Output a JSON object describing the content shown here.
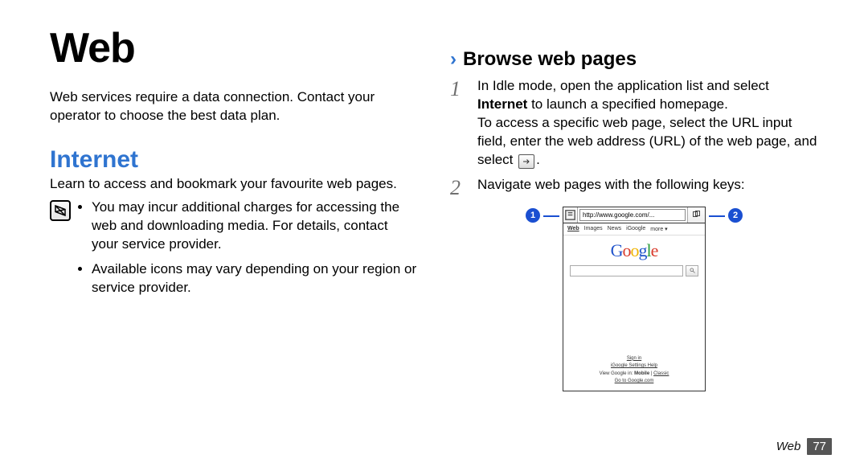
{
  "left": {
    "title": "Web",
    "intro": "Web services require a data connection. Contact your operator to choose the best data plan.",
    "section_title": "Internet",
    "section_desc": "Learn to access and bookmark your favourite web pages.",
    "notes": [
      "You may incur additional charges for accessing the web and downloading media. For details, contact your service provider.",
      "Available icons may vary depending on your region or service provider."
    ]
  },
  "right": {
    "sub_heading": "Browse web pages",
    "step1": {
      "num": "1",
      "line1_a": "In Idle mode, open the application list and select ",
      "line1_b": "Internet",
      "line1_c": " to launch a specified homepage.",
      "line2_a": "To access a specific web page, select the URL input field, enter the web address (URL) of the web page, and select ",
      "line2_b": "."
    },
    "step2": {
      "num": "2",
      "text": "Navigate web pages with the following keys:"
    },
    "callouts": {
      "left": "1",
      "right": "2"
    },
    "phone": {
      "url": "http://www.google.com/...",
      "nav": [
        "Web",
        "Images",
        "News",
        "iGoogle",
        "more ▾"
      ],
      "footer": {
        "signin": "Sign in",
        "links": "iGoogle   Settings   Help",
        "view_a": "View Google in: ",
        "view_b": "Mobile",
        "view_c": " | ",
        "view_d": "Classic",
        "goto": "Go to Google.com"
      }
    }
  },
  "footer": {
    "label": "Web",
    "page": "77"
  }
}
